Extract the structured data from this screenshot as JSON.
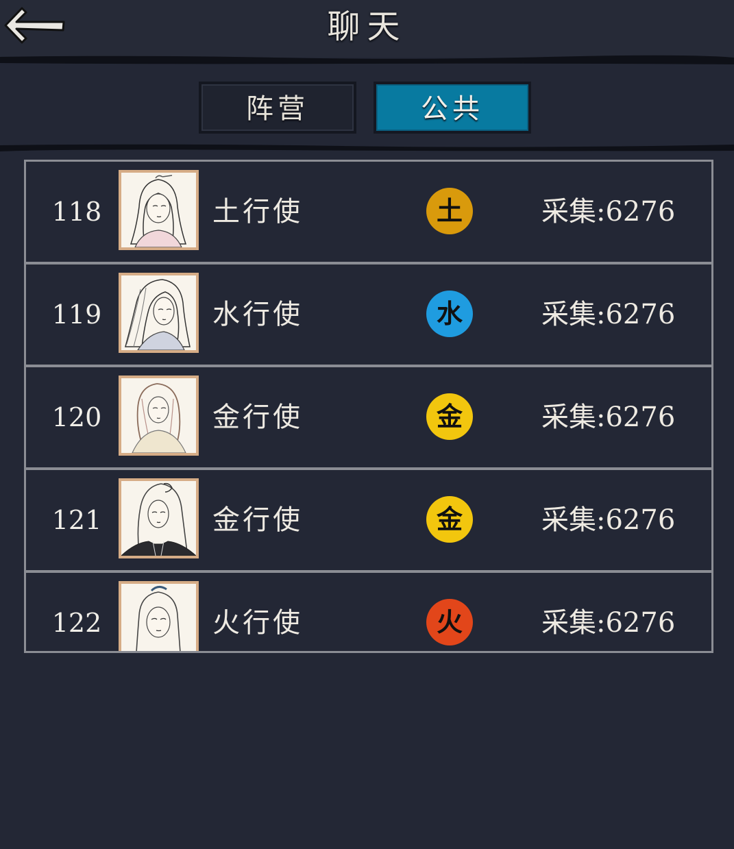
{
  "header": {
    "title": "聊天",
    "back_icon": "back-arrow-icon"
  },
  "tabs": [
    {
      "label": "阵营",
      "active": false
    },
    {
      "label": "公共",
      "active": true,
      "color": "#087aa0"
    }
  ],
  "rows": [
    {
      "rank": "118",
      "name": "土行使",
      "element": "土",
      "element_color": "#d99a0c",
      "stat": "采集:6276"
    },
    {
      "rank": "119",
      "name": "水行使",
      "element": "水",
      "element_color": "#1f9ce0",
      "stat": "采集:6276"
    },
    {
      "rank": "120",
      "name": "金行使",
      "element": "金",
      "element_color": "#f2c60e",
      "stat": "采集:6276"
    },
    {
      "rank": "121",
      "name": "金行使",
      "element": "金",
      "element_color": "#f2c60e",
      "stat": "采集:6276"
    },
    {
      "rank": "122",
      "name": "火行使",
      "element": "火",
      "element_color": "#e2461a",
      "stat": "采集:6276"
    }
  ]
}
